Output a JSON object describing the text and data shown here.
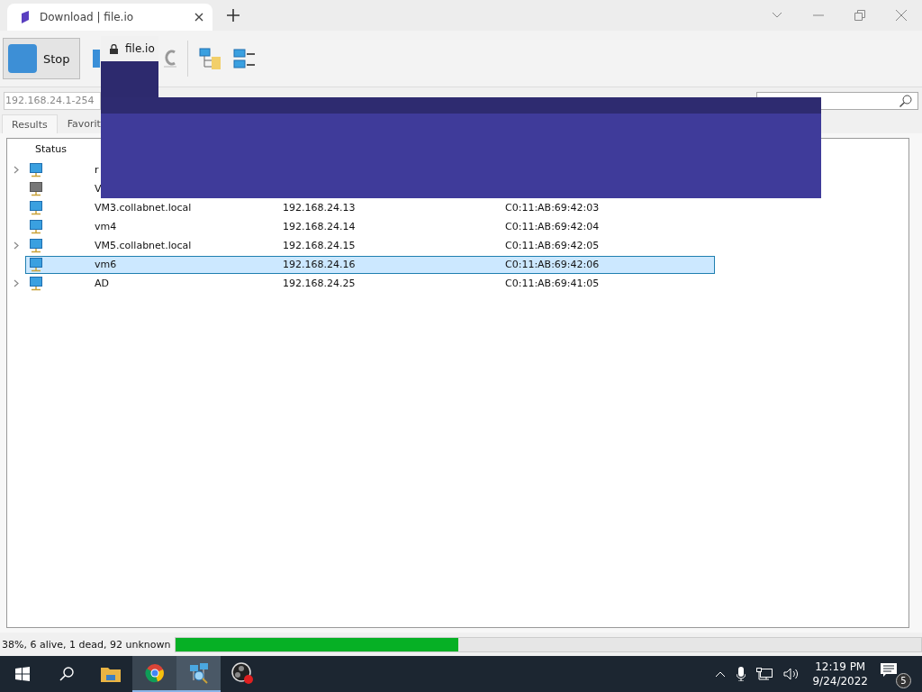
{
  "browser": {
    "tab": {
      "title": "Download | file.io",
      "selected": true
    },
    "popup": {
      "text": "file.io"
    }
  },
  "toolbar": {
    "buttons": [
      {
        "label": "Stop"
      }
    ]
  },
  "ip_range": {
    "value": "192.168.24.1-254"
  },
  "tabs": [
    {
      "label": "Results",
      "selected": true
    },
    {
      "label": "Favorit",
      "selected": false
    }
  ],
  "table": {
    "columns": [
      "Status"
    ],
    "rows": [
      {
        "expandable": true,
        "alive": true,
        "selected": false,
        "name": "r"
      },
      {
        "expandable": false,
        "alive": false,
        "selected": false,
        "name": "V"
      },
      {
        "expandable": false,
        "alive": true,
        "selected": false,
        "name": "VM3.collabnet.local",
        "ip": "192.168.24.13",
        "mac": "C0:11:AB:69:42:03"
      },
      {
        "expandable": false,
        "alive": true,
        "selected": false,
        "name": "vm4",
        "ip": "192.168.24.14",
        "mac": "C0:11:AB:69:42:04"
      },
      {
        "expandable": true,
        "alive": true,
        "selected": false,
        "name": "VM5.collabnet.local",
        "ip": "192.168.24.15",
        "mac": "C0:11:AB:69:42:05"
      },
      {
        "expandable": false,
        "alive": true,
        "selected": true,
        "name": "vm6",
        "ip": "192.168.24.16",
        "mac": "C0:11:AB:69:42:06"
      },
      {
        "expandable": true,
        "alive": true,
        "selected": false,
        "name": "AD",
        "ip": "192.168.24.25",
        "mac": "C0:11:AB:69:41:05"
      }
    ]
  },
  "status_bar": {
    "text": "38%, 6 alive, 1 dead, 92 unknown",
    "level": 0.38
  },
  "taskbar": {
    "time": "12:19 PM",
    "date": "9/24/2022",
    "notifications": "5"
  }
}
